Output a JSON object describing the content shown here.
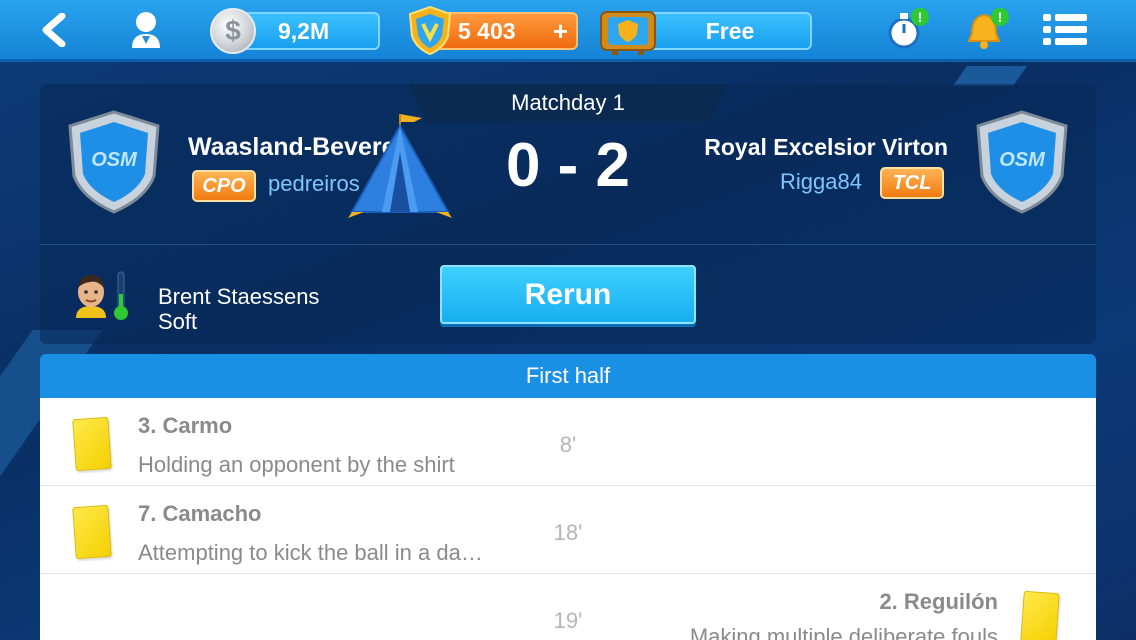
{
  "topbar": {
    "money": "9,2M",
    "money_symbol": "$",
    "tokens": "5 403",
    "tokens_plus": "+",
    "tv_label": "Free"
  },
  "match": {
    "matchday": "Matchday 1",
    "score": "0 - 2",
    "home": {
      "team": "Waasland-Beveren",
      "manager": "pedreiros",
      "league_badge": "CPO"
    },
    "away": {
      "team": "Royal Excelsior Virton",
      "manager": "Rigga84",
      "league_badge": "TCL"
    },
    "crest_text": "OSM"
  },
  "player": {
    "name": "Brent Staessens",
    "style": "Soft"
  },
  "rerun_label": "Rerun",
  "section_title": "First half",
  "events": [
    {
      "side": "home",
      "player": "3. Carmo",
      "description": "Holding an opponent by the shirt",
      "minute": "8'",
      "card": "yellow"
    },
    {
      "side": "home",
      "player": "7. Camacho",
      "description": "Attempting to kick the ball in a da…",
      "minute": "18'",
      "card": "yellow"
    },
    {
      "side": "away",
      "player": "2. Reguilón",
      "description": "Making multiple deliberate fouls",
      "minute": "19'",
      "card": "yellow"
    }
  ],
  "colors": {
    "topbar": "#1a90e4",
    "accent_orange": "#f07a10",
    "card_yellow": "#f4cf00",
    "manager_text": "#7fc6ff"
  }
}
